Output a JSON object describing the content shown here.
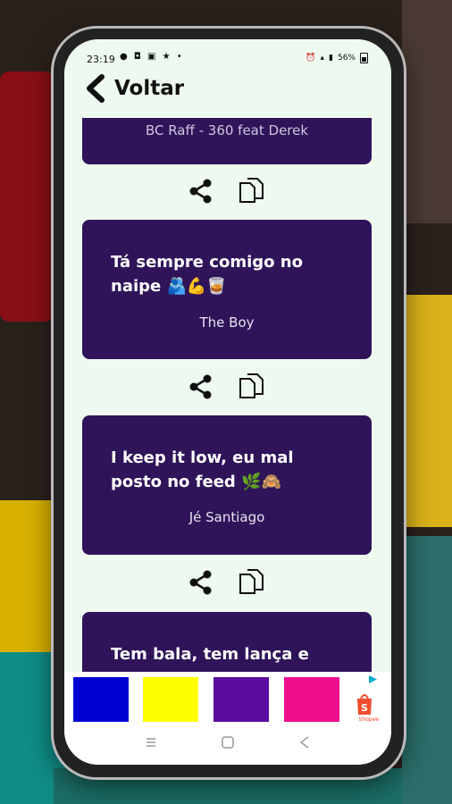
{
  "status_bar": {
    "time": "23:19",
    "left_icons": "● ◘ ▣ ★ •",
    "battery": "56%"
  },
  "app_bar": {
    "back_label": "Voltar"
  },
  "quotes": [
    {
      "text": "BC Raff - 360 feat Derek",
      "author": ""
    },
    {
      "text": "Tá sempre comigo no naipe 🫂💪🥃",
      "author": "The Boy"
    },
    {
      "text": "I keep it low, eu mal posto no feed 🌿🙈",
      "author": "Jé Santiago"
    },
    {
      "text": "Tem bala, tem lança e tem",
      "author": ""
    }
  ],
  "icons": {
    "share": "share-icon",
    "copy": "copy-icon",
    "back": "chevron-left-icon"
  },
  "ad": {
    "swatches": [
      "#0000d4",
      "#ffff00",
      "#5b0d9e",
      "#ef0e8e"
    ],
    "brand_label": "Shopee",
    "brand_color": "#ee4d2d"
  },
  "colors": {
    "card": "#2f1459",
    "background": "#eefaf0"
  }
}
